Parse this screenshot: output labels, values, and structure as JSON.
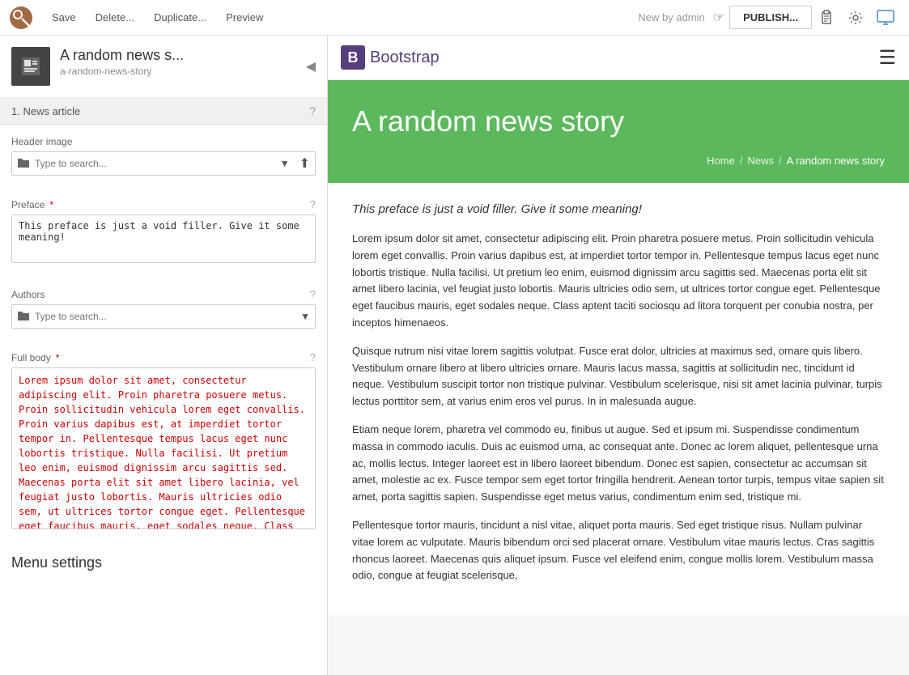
{
  "toolbar": {
    "save_label": "Save",
    "delete_label": "Delete...",
    "duplicate_label": "Duplicate...",
    "preview_label": "Preview",
    "status_text": "New",
    "status_by": "by admin",
    "publish_label": "PUBLISH...",
    "cursor_char": "☞"
  },
  "article": {
    "title": "A random news s...",
    "slug": "a-random-news-story",
    "section_label": "1. News article",
    "collapse_icon": "◀"
  },
  "header_image": {
    "label": "Header image",
    "placeholder": "Type to search..."
  },
  "preface": {
    "label": "Preface",
    "required": "*",
    "value": "This preface is just a void filler. Give it some meaning!"
  },
  "authors": {
    "label": "Authors",
    "placeholder": "Type to search..."
  },
  "full_body": {
    "label": "Full body",
    "required": "*",
    "value": "Lorem ipsum dolor sit amet, consectetur adipiscing elit. Proin pharetra posuere metus. Proin sollicitudin vehicula lorem eget convallis. Proin varius dapibus est, at imperdiet tortor tempor in. Pellentesque tempus lacus eget nunc lobortis tristique. Nulla facilisi. Ut pretium leo enim, euismod dignissim arcu sagittis sed. Maecenas porta elit sit amet libero lacinia, vel feugiat justo lobortis. Mauris ultricies odio sem, ut ultrices tortor congue eget. Pellentesque eget faucibus mauris, eget sodales neque. Class"
  },
  "menu_settings": {
    "title": "Menu settings"
  },
  "preview": {
    "bootstrap_name": "Bootstrap",
    "hero_title": "A random news story",
    "breadcrumb": [
      "Home",
      "News",
      "A random news story"
    ],
    "preface_italic": "This preface is just a void filler. Give it some meaning!",
    "paragraphs": [
      "Lorem ipsum dolor sit amet, consectetur adipiscing elit. Proin pharetra posuere metus. Proin sollicitudin vehicula lorem eget convallis. Proin varius dapibus est, at imperdiet tortor tempor in. Pellentesque tempus lacus eget nunc lobortis tristique. Nulla facilisi. Ut pretium leo enim, euismod dignissim arcu sagittis sed. Maecenas porta elit sit amet libero lacinia, vel feugiat justo lobortis. Mauris ultricies odio sem, ut ultrices tortor congue eget. Pellentesque eget faucibus mauris, eget sodales neque. Class aptent taciti sociosqu ad litora torquent per conubia nostra, per inceptos himenaeos.",
      "Quisque rutrum nisi vitae lorem sagittis volutpat. Fusce erat dolor, ultricies at maximus sed, ornare quis libero. Vestibulum ornare libero at libero ultricies ornare. Mauris lacus massa, sagittis at sollicitudin nec, tincidunt id neque. Vestibulum suscipit tortor non tristique pulvinar. Vestibulum scelerisque, nisi sit amet lacinia pulvinar, turpis lectus porttitor sem, at varius enim eros vel purus. In in malesuada augue.",
      "Etiam neque lorem, pharetra vel commodo eu, finibus ut augue. Sed et ipsum mi. Suspendisse condimentum massa in commodo iaculis. Duis ac euismod urna, ac consequat ante. Donec ac lorem aliquet, pellentesque urna ac, mollis lectus. Integer laoreet est in libero laoreet bibendum. Donec est sapien, consectetur ac accumsan sit amet, molestie ac ex. Fusce tempor sem eget tortor fringilla hendrerit. Aenean tortor turpis, tempus vitae sapien sit amet, porta sagittis sapien. Suspendisse eget metus varius, condimentum enim sed, tristique mi.",
      "Pellentesque tortor mauris, tincidunt a nisl vitae, aliquet porta mauris. Sed eget tristique risus. Nullam pulvinar vitae lorem ac vulputate. Mauris bibendum orci sed placerat ornare. Vestibulum vitae mauris lectus. Cras sagittis rhoncus laoreet. Maecenas quis aliquet ipsum. Fusce vel eleifend enim, congue mollis lorem. Vestibulum massa odio, congue at feugiat scelerisque,"
    ]
  }
}
